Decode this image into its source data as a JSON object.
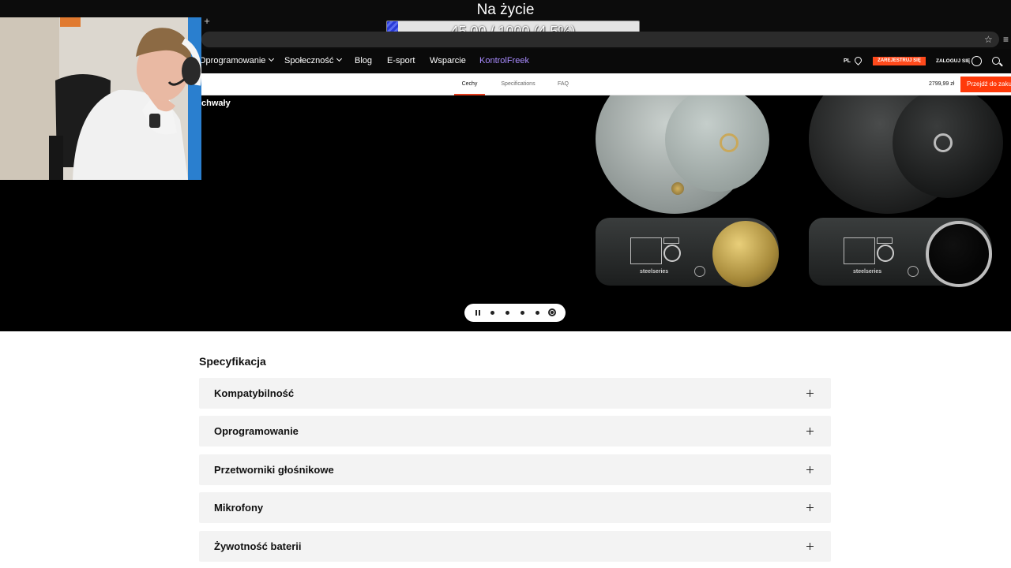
{
  "overlay": {
    "title": "Na życie",
    "goal_text": "45.00 / 1000 (4.5%)",
    "goal_progress": 0.045
  },
  "browser": {
    "new_tab_glyph": "+",
    "star_glyph": "☆",
    "menu_glyph": "≡"
  },
  "nav": {
    "items": [
      {
        "label": "Oprogramowanie"
      },
      {
        "label": "Społeczność"
      },
      {
        "label": "Blog"
      },
      {
        "label": "E-sport"
      },
      {
        "label": "Wsparcie"
      },
      {
        "label": "KontrolFreek"
      }
    ],
    "lang": "PL",
    "register": "ZAREJESTRUJ SIĘ",
    "login": "ZALOGUJ SIĘ"
  },
  "subnav": {
    "tabs": [
      {
        "label": "Cechy"
      },
      {
        "label": "Specifications"
      },
      {
        "label": "FAQ"
      }
    ],
    "price": "2799,99 zł",
    "cart": "Przejdź do zakupu"
  },
  "hero": {
    "caption": "chwały",
    "brand": "steelseries"
  },
  "specs": {
    "heading": "Specyfikacja",
    "items": [
      {
        "label": "Kompatybilność"
      },
      {
        "label": "Oprogramowanie"
      },
      {
        "label": "Przetworniki głośnikowe"
      },
      {
        "label": "Mikrofony"
      },
      {
        "label": "Żywotność baterii"
      }
    ]
  },
  "colors": {
    "accent_orange": "#ff4a1c",
    "kontrolfreek": "#a98bff",
    "hero_bg": "#000000"
  }
}
